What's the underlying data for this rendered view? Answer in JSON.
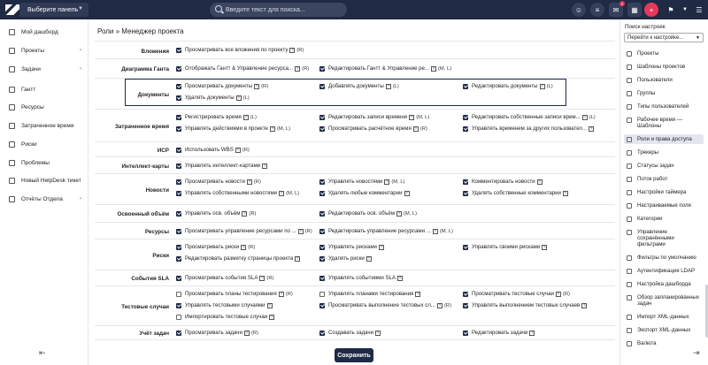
{
  "topbar": {
    "panel_select": "Выберите панель",
    "search_placeholder": "Введите текст для поиска...",
    "notifications_count": "2"
  },
  "sidebar": {
    "items": [
      {
        "label": "Мой дашборд",
        "icon": "dashboard-icon",
        "caret": false
      },
      {
        "label": "Проекты",
        "icon": "projects-icon",
        "caret": true
      },
      {
        "label": "Задачи",
        "icon": "tasks-icon",
        "caret": true
      },
      {
        "label": "Гантт",
        "icon": "gantt-icon",
        "caret": false
      },
      {
        "label": "Ресурсы",
        "icon": "resources-icon",
        "caret": false
      },
      {
        "label": "Затраченное время",
        "icon": "time-icon",
        "caret": false
      },
      {
        "label": "Риски",
        "icon": "risks-icon",
        "caret": false
      },
      {
        "label": "Проблемы",
        "icon": "problems-icon",
        "caret": false
      },
      {
        "label": "Новый HelpDesk тикет",
        "icon": "helpdesk-icon",
        "caret": false
      },
      {
        "label": "Отчёты Отдела",
        "icon": "reports-icon",
        "caret": true
      }
    ]
  },
  "main": {
    "title": "Роли » Менеджер проекта",
    "save_label": "Сохранить",
    "rows": [
      {
        "label": "Вложения",
        "perms": [
          {
            "text": "Просматривать все вложения по проекту",
            "tag": "(R)",
            "on": true
          }
        ]
      },
      {
        "label": "Диаграмма Ганта",
        "perms": [
          {
            "text": "Отображать Гантт & Управление ресурса...",
            "tag": "(R)",
            "on": true
          },
          {
            "text": "Редактировать Гантт & Управление ре...",
            "tag": "(M, L)",
            "on": true
          }
        ]
      },
      {
        "label": "Документы",
        "perms": [
          {
            "text": "Просматривать документы",
            "tag": "(R)",
            "on": true
          },
          {
            "text": "Добавлять документы",
            "tag": "(L)",
            "on": true
          },
          {
            "text": "Редактировать документы",
            "tag": "(L)",
            "on": true
          },
          {
            "text": "Удалять документы",
            "tag": "(L)",
            "on": true
          }
        ]
      },
      {
        "label": "Затраченное время",
        "perms": [
          {
            "text": "Регистрировать время",
            "tag": "(L)",
            "on": true
          },
          {
            "text": "Редактировать записи времени",
            "tag": "(M, L)",
            "on": true
          },
          {
            "text": "Редактировать собственные записи врем...",
            "tag": "(L)",
            "on": true
          },
          {
            "text": "Управлять действиями в проекте",
            "tag": "(M, L)",
            "on": true
          },
          {
            "text": "Просматривать расчётное время",
            "tag": "(R)",
            "on": true
          },
          {
            "text": "Управлять временем за других пользовател...",
            "tag": "",
            "on": true
          }
        ]
      },
      {
        "label": "ИСР",
        "perms": [
          {
            "text": "Использовать WBS",
            "tag": "(R)",
            "on": true
          }
        ]
      },
      {
        "label": "Интеллект-карты",
        "perms": [
          {
            "text": "Управлять интеллект-картами",
            "tag": "",
            "on": true
          }
        ]
      },
      {
        "label": "Новости",
        "perms": [
          {
            "text": "Просматривать новости",
            "tag": "(R)",
            "on": true
          },
          {
            "text": "Управлять новостями",
            "tag": "(M, L)",
            "on": true
          },
          {
            "text": "Комментировать новости",
            "tag": "",
            "on": true
          },
          {
            "text": "Управлять собственными новостями",
            "tag": "(M, L)",
            "on": true
          },
          {
            "text": "Удалять любые комментарии",
            "tag": "",
            "on": true
          },
          {
            "text": "Удалять собственные комментарии",
            "tag": "",
            "on": true
          }
        ]
      },
      {
        "label": "Освоенный объём",
        "perms": [
          {
            "text": "Управлять осв. объём",
            "tag": "(R)",
            "on": true
          },
          {
            "text": "Редактировать осв. объём",
            "tag": "(M, L)",
            "on": true
          }
        ]
      },
      {
        "label": "Ресурсы",
        "perms": [
          {
            "text": "Просматривать управление ресурсами по ...",
            "tag": "(R)",
            "on": true
          },
          {
            "text": "Редактировать управление ресурсами ...",
            "tag": "(M, L)",
            "on": true
          }
        ]
      },
      {
        "label": "Риски",
        "perms": [
          {
            "text": "Просматривать риски",
            "tag": "(R)",
            "on": true
          },
          {
            "text": "Управлять рисками",
            "tag": "",
            "on": true
          },
          {
            "text": "Управлять своими рисками",
            "tag": "",
            "on": true
          },
          {
            "text": "Редактировать разметку страницы проекта",
            "tag": "",
            "on": true
          },
          {
            "text": "Удалять риски",
            "tag": "",
            "on": true
          }
        ]
      },
      {
        "label": "События SLA",
        "perms": [
          {
            "text": "Просматривать события SLA",
            "tag": "(R)",
            "on": true
          },
          {
            "text": "Управлять событиями SLA",
            "tag": "",
            "on": true
          }
        ]
      },
      {
        "label": "Тестовые случаи",
        "perms": [
          {
            "text": "Просматривать планы тестирования",
            "tag": "(R)",
            "on": false
          },
          {
            "text": "Управлять планами тестирования",
            "tag": "",
            "on": false
          },
          {
            "text": "Просматривать тестовые случаи",
            "tag": "(R)",
            "on": true
          },
          {
            "text": "Управлять тестовыми случаями",
            "tag": "",
            "on": true
          },
          {
            "text": "Просматривать выполнение тестовых сл...",
            "tag": "(R)",
            "on": true
          },
          {
            "text": "Управлять выполнением тестовых случаев",
            "tag": "",
            "on": true
          },
          {
            "text": "Импортировать тестовые случаи",
            "tag": "",
            "on": false
          }
        ]
      },
      {
        "label": "Учёт задач",
        "perms": [
          {
            "text": "Просматривать задачи",
            "tag": "(R)",
            "on": true
          },
          {
            "text": "Создавать задачи",
            "tag": "",
            "on": true
          },
          {
            "text": "Редактировать задачи",
            "tag": "",
            "on": true
          }
        ]
      }
    ]
  },
  "right_sidebar": {
    "search_title": "Поиск настроек",
    "goto_select": "Перейти к настройке...",
    "items": [
      {
        "label": "Проекты",
        "active": false
      },
      {
        "label": "Шаблоны проектов",
        "active": false
      },
      {
        "label": "Пользователи",
        "active": false
      },
      {
        "label": "Группы",
        "active": false
      },
      {
        "label": "Типы пользователей",
        "active": false
      },
      {
        "label": "Рабочее время — Шаблоны",
        "active": false
      },
      {
        "label": "Роли и права доступа",
        "active": true
      },
      {
        "label": "Трекеры",
        "active": false
      },
      {
        "label": "Статусы задач",
        "active": false
      },
      {
        "label": "Поток работ",
        "active": false
      },
      {
        "label": "Настройки таймера",
        "active": false
      },
      {
        "label": "Настраиваемые поля",
        "active": false
      },
      {
        "label": "Категории",
        "active": false
      },
      {
        "label": "Управление сохранёнными фильтрами",
        "active": false
      },
      {
        "label": "Фильтры по умолчанию",
        "active": false
      },
      {
        "label": "Аутентификация LDAP",
        "active": false
      },
      {
        "label": "Настройка дашборда",
        "active": false
      },
      {
        "label": "Обзор запланированных задач",
        "active": false
      },
      {
        "label": "Импорт XML-данных",
        "active": false
      },
      {
        "label": "Экспорт XML-данных",
        "active": false
      },
      {
        "label": "Валюта",
        "active": false
      }
    ]
  },
  "colors": {
    "topbar": "#1f2a44",
    "accent": "#e5395b",
    "checkbox": "#1f2a44"
  }
}
